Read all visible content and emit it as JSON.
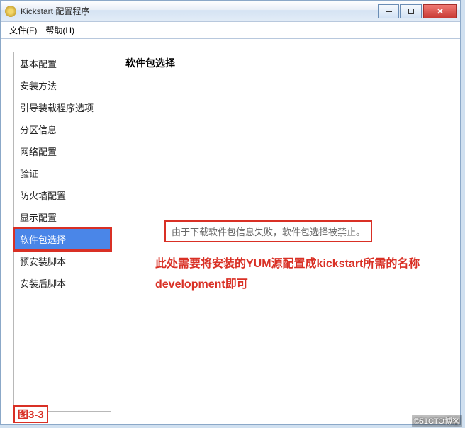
{
  "titlebar": {
    "title": "Kickstart 配置程序"
  },
  "menubar": {
    "file": "文件(F)",
    "help": "帮助(H)"
  },
  "sidebar": {
    "items": [
      {
        "label": "基本配置"
      },
      {
        "label": "安装方法"
      },
      {
        "label": "引导装载程序选项"
      },
      {
        "label": "分区信息"
      },
      {
        "label": "网络配置"
      },
      {
        "label": "验证"
      },
      {
        "label": "防火墙配置"
      },
      {
        "label": "显示配置"
      },
      {
        "label": "软件包选择"
      },
      {
        "label": "预安装脚本"
      },
      {
        "label": "安装后脚本"
      }
    ],
    "selected_index": 8
  },
  "content": {
    "heading": "软件包选择",
    "error_message": "由于下载软件包信息失败，软件包选择被禁止。"
  },
  "annotations": {
    "explain": "此处需要将安装的YUM源配置成kickstart所需的名称development即可",
    "figure_label": "图3-3"
  },
  "watermark": "©51CTO博客"
}
